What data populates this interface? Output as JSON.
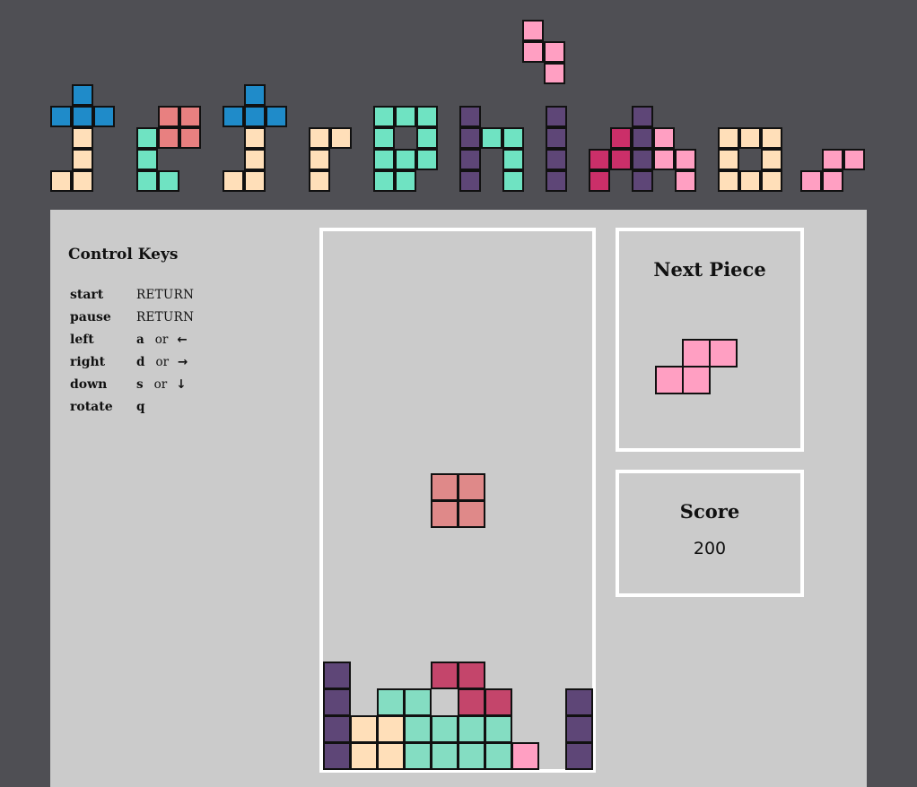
{
  "colors": {
    "background": "#4f4f54",
    "panel": "#cbcbcb",
    "blue": "#1f8bc9",
    "peach": "#ffdfb9",
    "salmon": "#e88080",
    "mint": "#6fe3c2",
    "purple": "#5e4677",
    "magenta": "#cb2f69",
    "pink": "#ff9fc2",
    "board_salmon": "#df8989",
    "board_crimson": "#c4456b",
    "board_mint": "#84ddc2"
  },
  "logo": {
    "title_blocks": "tetronimo-block-letters"
  },
  "controls": {
    "title": "Control Keys",
    "keys": [
      {
        "action": "start",
        "key": "RETURN"
      },
      {
        "action": "pause",
        "key": "RETURN"
      },
      {
        "action": "left",
        "key": "a",
        "or": "or",
        "arrow": "←"
      },
      {
        "action": "right",
        "key": "d",
        "or": "or",
        "arrow": "→"
      },
      {
        "action": "down",
        "key": "s",
        "or": "or",
        "arrow": "↓"
      },
      {
        "action": "rotate",
        "key": "q"
      }
    ]
  },
  "next_piece": {
    "title": "Next Piece",
    "shape": "S",
    "color": "pink"
  },
  "score": {
    "title": "Score",
    "value": "200"
  },
  "board": {
    "columns": 10,
    "rows": 20,
    "falling_piece": {
      "shape": "O",
      "color": "board_salmon",
      "cells": [
        [
          4,
          9
        ],
        [
          5,
          9
        ],
        [
          4,
          10
        ],
        [
          5,
          10
        ]
      ]
    },
    "settled": [
      {
        "col": 0,
        "row": 16,
        "color": "purple"
      },
      {
        "col": 4,
        "row": 16,
        "color": "board_crimson"
      },
      {
        "col": 5,
        "row": 16,
        "color": "board_crimson"
      },
      {
        "col": 0,
        "row": 17,
        "color": "purple"
      },
      {
        "col": 2,
        "row": 17,
        "color": "board_mint"
      },
      {
        "col": 3,
        "row": 17,
        "color": "board_mint"
      },
      {
        "col": 5,
        "row": 17,
        "color": "board_crimson"
      },
      {
        "col": 6,
        "row": 17,
        "color": "board_crimson"
      },
      {
        "col": 9,
        "row": 17,
        "color": "purple"
      },
      {
        "col": 0,
        "row": 18,
        "color": "purple"
      },
      {
        "col": 1,
        "row": 18,
        "color": "peach"
      },
      {
        "col": 2,
        "row": 18,
        "color": "peach"
      },
      {
        "col": 3,
        "row": 18,
        "color": "board_mint"
      },
      {
        "col": 4,
        "row": 18,
        "color": "board_mint"
      },
      {
        "col": 5,
        "row": 18,
        "color": "board_mint"
      },
      {
        "col": 6,
        "row": 18,
        "color": "board_mint"
      },
      {
        "col": 9,
        "row": 18,
        "color": "purple"
      },
      {
        "col": 0,
        "row": 19,
        "color": "purple"
      },
      {
        "col": 1,
        "row": 19,
        "color": "peach"
      },
      {
        "col": 2,
        "row": 19,
        "color": "peach"
      },
      {
        "col": 3,
        "row": 19,
        "color": "board_mint"
      },
      {
        "col": 4,
        "row": 19,
        "color": "board_mint"
      },
      {
        "col": 5,
        "row": 19,
        "color": "board_mint"
      },
      {
        "col": 6,
        "row": 19,
        "color": "board_mint"
      },
      {
        "col": 7,
        "row": 19,
        "color": "pink"
      },
      {
        "col": 9,
        "row": 19,
        "color": "purple"
      }
    ]
  }
}
